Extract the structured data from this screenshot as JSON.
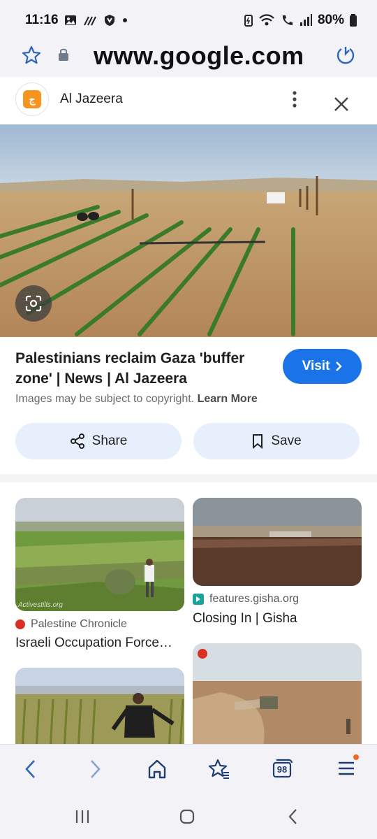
{
  "status_bar": {
    "time": "11:16",
    "battery_pct": "80%"
  },
  "url_bar": {
    "url": "www.google.com"
  },
  "card": {
    "source_name": "Al Jazeera",
    "title": "Palestinians reclaim Gaza 'buffer zone' | News | Al Jazeera",
    "visit_label": "Visit",
    "copyright_text": "Images may be subject to copyright.",
    "learn_more": "Learn More",
    "share_label": "Share",
    "save_label": "Save"
  },
  "related": [
    {
      "source": "Palestine Chronicle",
      "title": "Israeli Occupation Force…",
      "watermark": "Activestills.org"
    },
    {
      "source": "features.gisha.org",
      "title": "Closing In | Gisha"
    }
  ],
  "bottom_nav": {
    "tab_count": "98"
  },
  "colors": {
    "accent": "#1a73e8",
    "chip_bg": "#e8effc",
    "chrome_bg": "#f2f2f7",
    "aljazeera_orange": "#f7941d"
  }
}
